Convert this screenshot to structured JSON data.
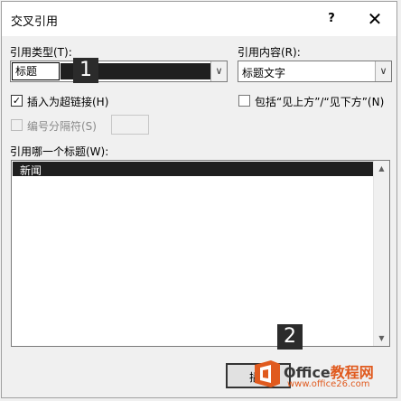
{
  "dialog": {
    "title": "交叉引用",
    "help": "?",
    "close": "✕"
  },
  "ref_type": {
    "label": "引用类型(T):",
    "value": "标题"
  },
  "ref_content": {
    "label": "引用内容(R):",
    "value": "标题文字"
  },
  "hyperlink": {
    "label": "插入为超链接(H)",
    "checked": true
  },
  "include_above_below": {
    "label": "包括“见上方”/“见下方”(N)",
    "checked": false
  },
  "number_separator": {
    "label": "编号分隔符(S)",
    "checked": false
  },
  "which_heading": {
    "label": "引用哪一个标题(W):",
    "items": [
      "新闻"
    ]
  },
  "buttons": {
    "insert": "插入"
  },
  "badges": [
    "1",
    "2"
  ],
  "watermark": {
    "brand_a": "Office",
    "brand_b": "教程网",
    "url": "www.office26.com"
  },
  "colors": {
    "selection": "#1f1f1f",
    "office_orange": "#e05a1e"
  }
}
